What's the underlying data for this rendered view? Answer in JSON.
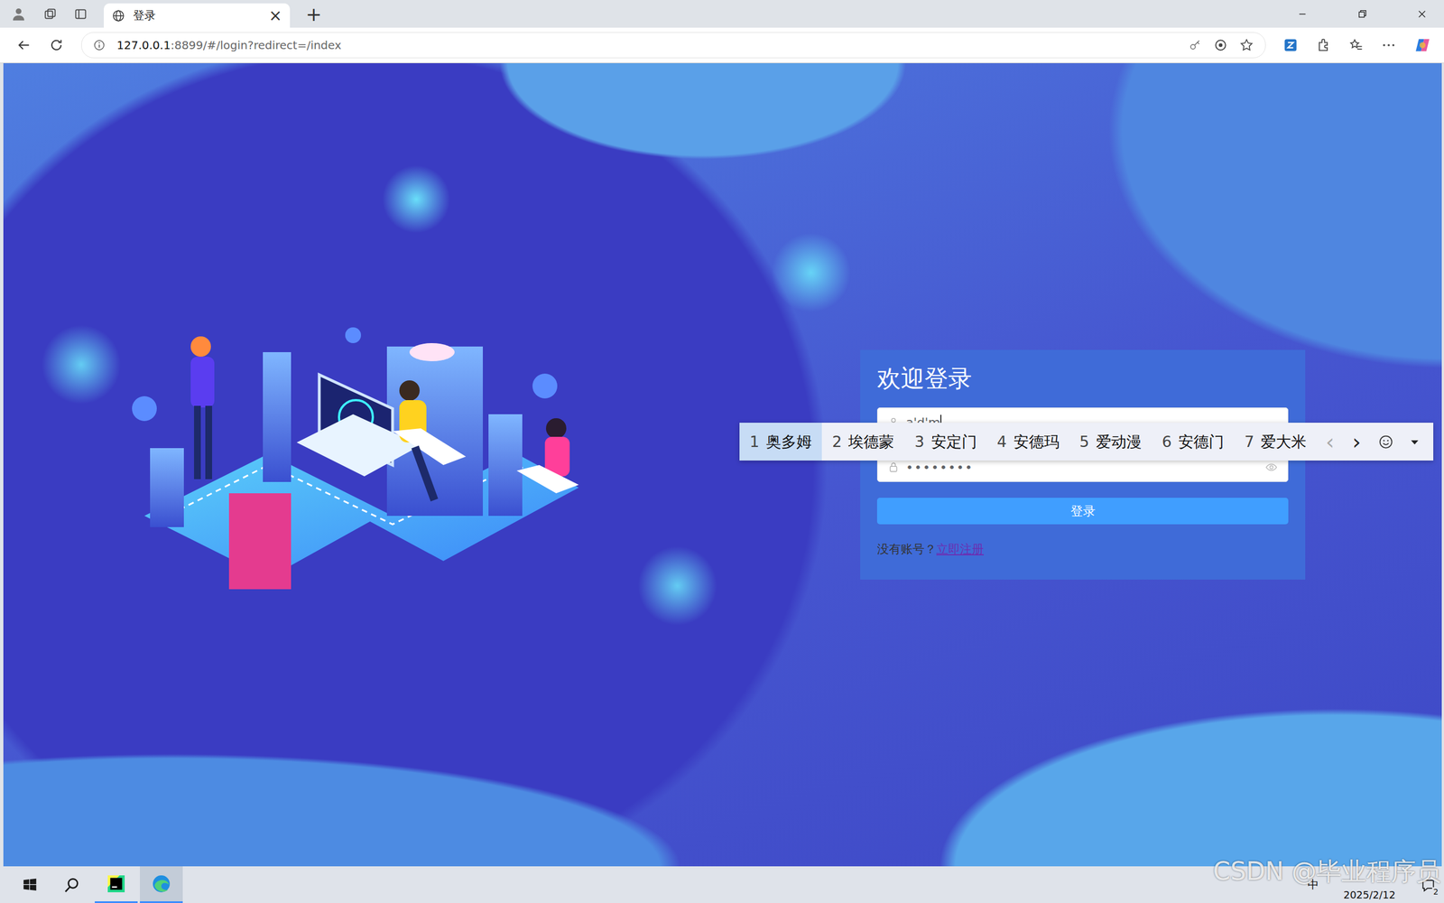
{
  "browser": {
    "tab_title": "登录",
    "tab_close": "×",
    "new_tab": "+",
    "url_host": "127.0.0.1",
    "url_rest": ":8899/#/login?redirect=/index"
  },
  "login": {
    "title": "欢迎登录",
    "username": "a'd'm",
    "password": "••••••••",
    "button": "登录",
    "prompt": "没有账号？",
    "register_link": "立即注册"
  },
  "ime": {
    "candidates": [
      {
        "index": "1",
        "text": "奥多姆",
        "selected": true
      },
      {
        "index": "2",
        "text": "埃德蒙",
        "selected": false
      },
      {
        "index": "3",
        "text": "安定门",
        "selected": false
      },
      {
        "index": "4",
        "text": "安德玛",
        "selected": false
      },
      {
        "index": "5",
        "text": "爱动漫",
        "selected": false
      },
      {
        "index": "6",
        "text": "安德门",
        "selected": false
      },
      {
        "index": "7",
        "text": "爱大米",
        "selected": false
      }
    ],
    "prev": "‹",
    "next": "›"
  },
  "taskbar": {
    "ime_mode": "中",
    "date": "2025/2/12",
    "notifications": "2"
  },
  "watermark": "CSDN @毕业程序员"
}
